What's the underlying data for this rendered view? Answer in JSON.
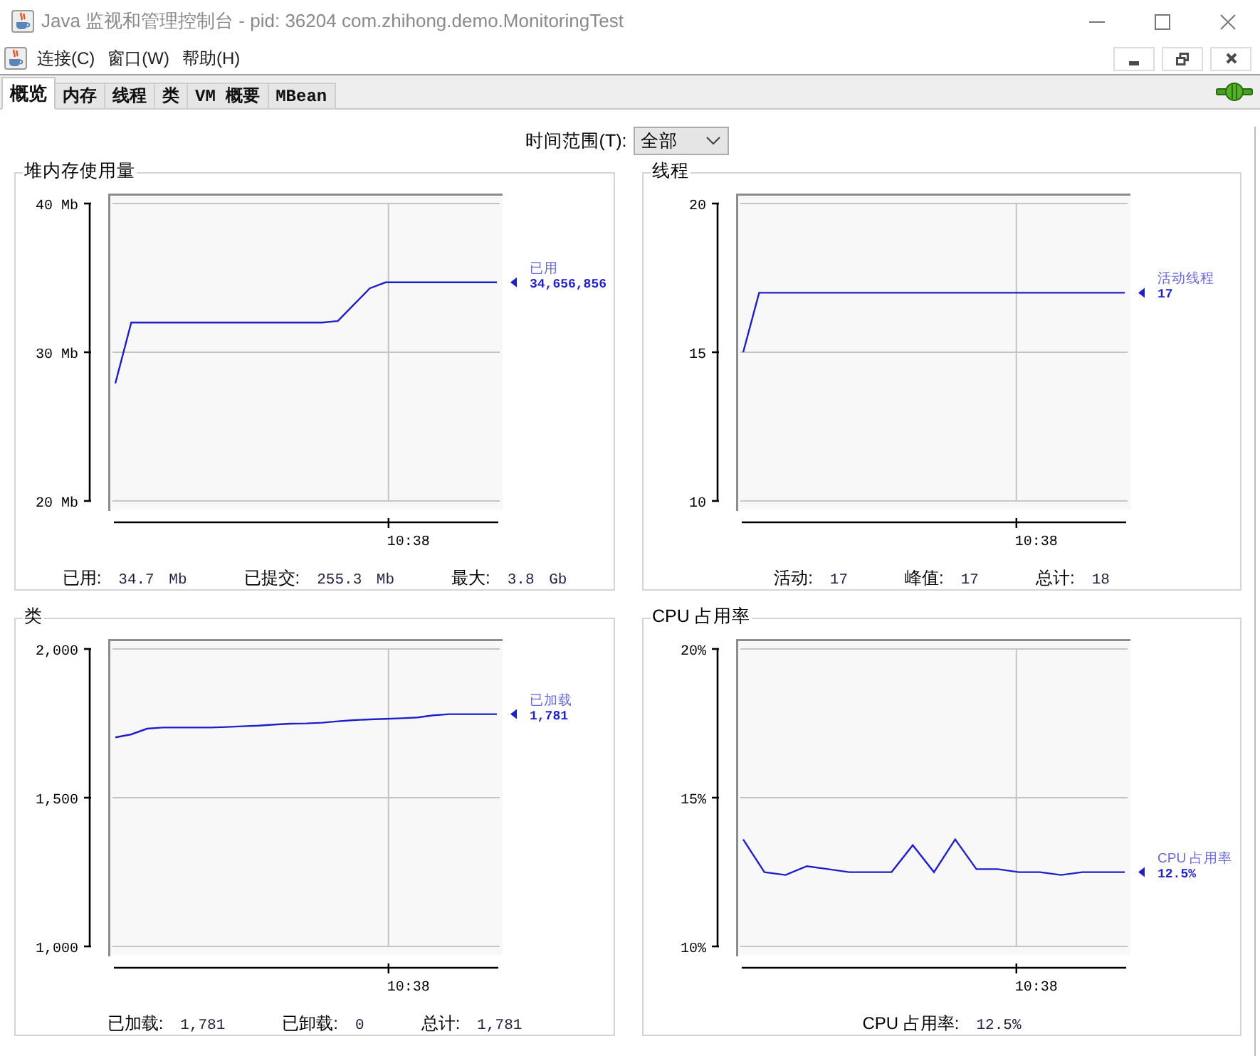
{
  "window": {
    "title": "Java 监视和管理控制台 - pid: 36204 com.zhihong.demo.MonitoringTest"
  },
  "menu_bar": {
    "items": [
      "连接(C)",
      "窗口(W)",
      "帮助(H)"
    ]
  },
  "tabs": [
    {
      "label": "概览",
      "selected": true
    },
    {
      "label": "内存",
      "selected": false
    },
    {
      "label": "线程",
      "selected": false
    },
    {
      "label": "类",
      "selected": false
    },
    {
      "label": "VM 概要",
      "selected": false
    },
    {
      "label": "MBean",
      "selected": false
    }
  ],
  "time_range": {
    "label": "时间范围(T):",
    "value": "全部"
  },
  "panels": [
    {
      "title": "堆内存使用量",
      "legend_value": "34,656,856",
      "stats": [
        {
          "label": "已用:",
          "value": "34.7 Mb"
        },
        {
          "label": "已提交:",
          "value": "255.3 Mb"
        },
        {
          "label": "最大:",
          "value": "3.8 Gb"
        }
      ],
      "chart_data": {
        "type": "line",
        "ylim": [
          20,
          40
        ],
        "yticks": [
          {
            "value": 20,
            "label": "20 Mb"
          },
          {
            "value": 30,
            "label": "30 Mb"
          },
          {
            "value": 40,
            "label": "40 Mb"
          }
        ],
        "annotations": [
          "10:38"
        ],
        "series": [
          {
            "name": "已用",
            "color": "#1f1fc8",
            "values": [
              27.9,
              32,
              32,
              32,
              32,
              32,
              32,
              32,
              32,
              32,
              32,
              32,
              32,
              32,
              32.1,
              33.2,
              34.3,
              34.7,
              34.7,
              34.7,
              34.7,
              34.7,
              34.7,
              34.7,
              34.7
            ]
          }
        ]
      }
    },
    {
      "title": "线程",
      "legend_value": "17",
      "stats": [
        {
          "label": "活动:",
          "value": "17"
        },
        {
          "label": "峰值:",
          "value": "17"
        },
        {
          "label": "总计:",
          "value": "18"
        }
      ],
      "chart_data": {
        "type": "line",
        "ylim": [
          10,
          20
        ],
        "yticks": [
          {
            "value": 10,
            "label": "10"
          },
          {
            "value": 15,
            "label": "15"
          },
          {
            "value": 20,
            "label": "20"
          }
        ],
        "annotations": [
          "10:38"
        ],
        "series": [
          {
            "name": "活动线程",
            "color": "#1f1fc8",
            "values": [
              15,
              17,
              17,
              17,
              17,
              17,
              17,
              17,
              17,
              17,
              17,
              17,
              17,
              17,
              17,
              17,
              17,
              17,
              17,
              17,
              17,
              17,
              17,
              17,
              17
            ]
          }
        ]
      }
    },
    {
      "title": "类",
      "legend_value": "1,781",
      "stats": [
        {
          "label": "已加载:",
          "value": "1,781"
        },
        {
          "label": "已卸载:",
          "value": "0"
        },
        {
          "label": "总计:",
          "value": "1,781"
        }
      ],
      "chart_data": {
        "type": "line",
        "ylim": [
          1000,
          2000
        ],
        "yticks": [
          {
            "value": 1000,
            "label": "1,000"
          },
          {
            "value": 1500,
            "label": "1,500"
          },
          {
            "value": 2000,
            "label": "2,000"
          }
        ],
        "annotations": [
          "10:38"
        ],
        "series": [
          {
            "name": "已加载",
            "color": "#1f1fc8",
            "values": [
              1703,
              1713,
              1732,
              1736,
              1736,
              1736,
              1736,
              1738,
              1740,
              1742,
              1746,
              1749,
              1750,
              1752,
              1757,
              1761,
              1763,
              1765,
              1767,
              1770,
              1777,
              1781,
              1781,
              1781,
              1781
            ]
          }
        ]
      }
    },
    {
      "title": "CPU 占用率",
      "legend_value": "12.5%",
      "stats": [
        {
          "label": "CPU 占用率:",
          "value": "12.5%"
        }
      ],
      "chart_data": {
        "type": "line",
        "ylim": [
          10,
          20
        ],
        "yticks": [
          {
            "value": 10,
            "label": "10%"
          },
          {
            "value": 15,
            "label": "15%"
          },
          {
            "value": 20,
            "label": "20%"
          }
        ],
        "annotations": [
          "10:38"
        ],
        "series": [
          {
            "name": "CPU 占用率",
            "color": "#1f1fc8",
            "values": [
              13.6,
              12.5,
              12.4,
              12.7,
              12.6,
              12.5,
              12.5,
              12.5,
              13.4,
              12.5,
              13.6,
              12.6,
              12.6,
              12.5,
              12.5,
              12.4,
              12.5,
              12.5,
              12.5
            ]
          }
        ]
      }
    }
  ]
}
